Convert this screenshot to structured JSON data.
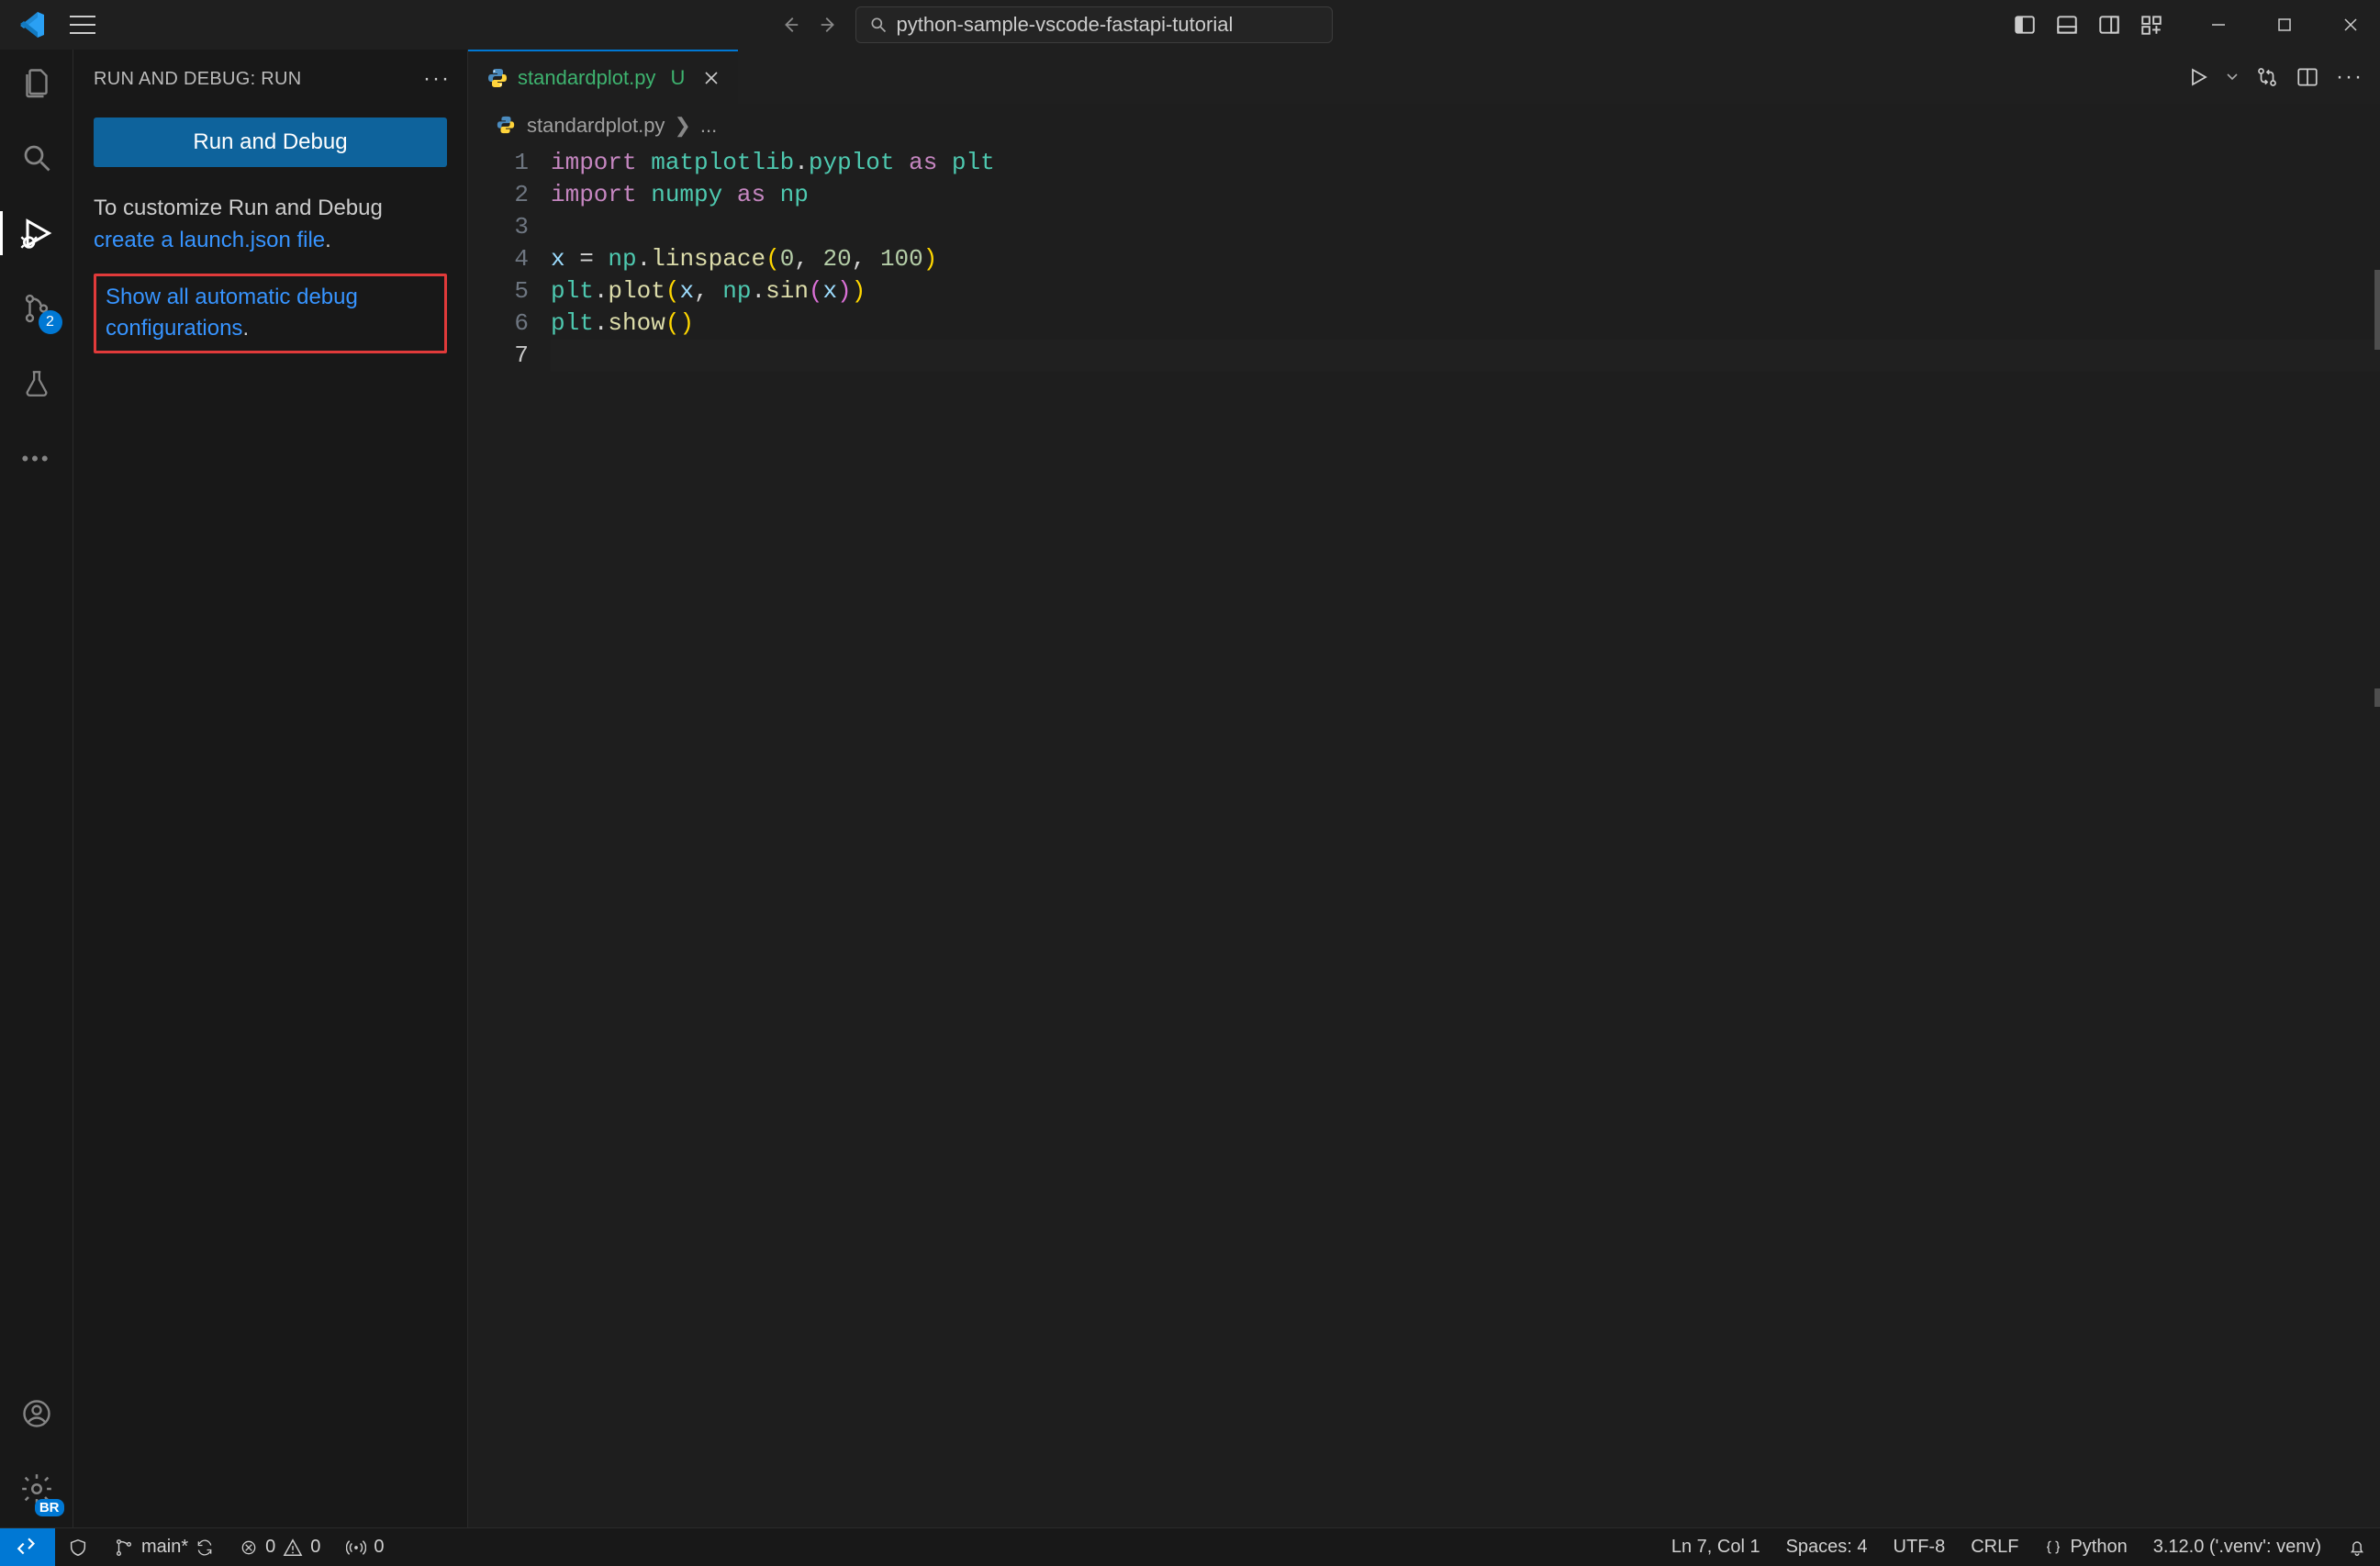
{
  "title_bar": {
    "search_text": "python-sample-vscode-fastapi-tutorial"
  },
  "activity": {
    "source_control_badge": "2",
    "settings_badge": "BR"
  },
  "sidebar": {
    "title": "RUN AND DEBUG: RUN",
    "run_debug_button": "Run and Debug",
    "customize_prefix": "To customize Run and Debug ",
    "create_launch_link": "create a launch.json file",
    "customize_suffix": ".",
    "show_all_link": "Show all automatic debug configurations",
    "show_all_suffix": "."
  },
  "editor": {
    "tab_filename": "standardplot.py",
    "tab_modified_flag": "U",
    "breadcrumb_file": "standardplot.py",
    "breadcrumb_tail": "...",
    "line_numbers": [
      "1",
      "2",
      "3",
      "4",
      "5",
      "6",
      "7"
    ],
    "code_tokens": [
      [
        {
          "t": "import ",
          "c": "kw"
        },
        {
          "t": "matplotlib",
          "c": "mod"
        },
        {
          "t": ".",
          "c": "op"
        },
        {
          "t": "pyplot",
          "c": "mod"
        },
        {
          "t": " as ",
          "c": "kw"
        },
        {
          "t": "plt",
          "c": "mod"
        }
      ],
      [
        {
          "t": "import ",
          "c": "kw"
        },
        {
          "t": "numpy",
          "c": "mod"
        },
        {
          "t": " as ",
          "c": "kw"
        },
        {
          "t": "np",
          "c": "mod"
        }
      ],
      [],
      [
        {
          "t": "x",
          "c": "var"
        },
        {
          "t": " = ",
          "c": "op"
        },
        {
          "t": "np",
          "c": "mod"
        },
        {
          "t": ".",
          "c": "op"
        },
        {
          "t": "linspace",
          "c": "fn"
        },
        {
          "t": "(",
          "c": "bracket1"
        },
        {
          "t": "0",
          "c": "num"
        },
        {
          "t": ", ",
          "c": "op"
        },
        {
          "t": "20",
          "c": "num"
        },
        {
          "t": ", ",
          "c": "op"
        },
        {
          "t": "100",
          "c": "num"
        },
        {
          "t": ")",
          "c": "bracket1"
        }
      ],
      [
        {
          "t": "plt",
          "c": "mod"
        },
        {
          "t": ".",
          "c": "op"
        },
        {
          "t": "plot",
          "c": "fn"
        },
        {
          "t": "(",
          "c": "bracket1"
        },
        {
          "t": "x",
          "c": "var"
        },
        {
          "t": ", ",
          "c": "op"
        },
        {
          "t": "np",
          "c": "mod"
        },
        {
          "t": ".",
          "c": "op"
        },
        {
          "t": "sin",
          "c": "fn"
        },
        {
          "t": "(",
          "c": "bracket2"
        },
        {
          "t": "x",
          "c": "var"
        },
        {
          "t": ")",
          "c": "bracket2"
        },
        {
          "t": ")",
          "c": "bracket1"
        }
      ],
      [
        {
          "t": "plt",
          "c": "mod"
        },
        {
          "t": ".",
          "c": "op"
        },
        {
          "t": "show",
          "c": "fn"
        },
        {
          "t": "(",
          "c": "bracket1"
        },
        {
          "t": ")",
          "c": "bracket1"
        }
      ],
      []
    ]
  },
  "status_bar": {
    "branch": "main*",
    "errors": "0",
    "warnings": "0",
    "ports": "0",
    "cursor": "Ln 7, Col 1",
    "spaces": "Spaces: 4",
    "encoding": "UTF-8",
    "eol": "CRLF",
    "lang": "Python",
    "interpreter": "3.12.0 ('.venv': venv)"
  }
}
